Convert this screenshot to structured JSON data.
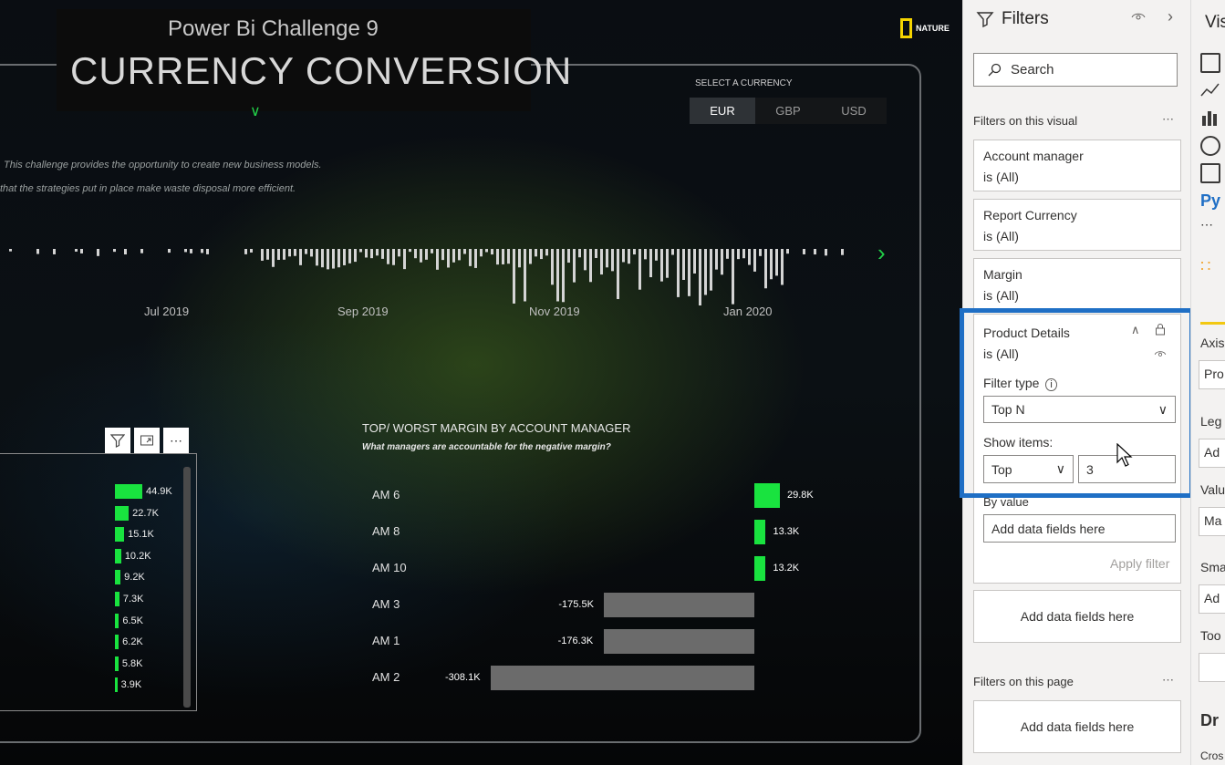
{
  "report": {
    "subtitle": "Power Bi Challenge 9",
    "title": "CURRENCY CONVERSION",
    "logo_text": "NATURE",
    "currency_label": "SELECT A CURRENCY",
    "currencies": [
      "EUR",
      "GBP",
      "USD"
    ],
    "selected_currency": "EUR",
    "description_line1": "This challenge provides the opportunity to create new business models.",
    "description_line2": "that the strategies put in place make waste disposal more efficient.",
    "timeline_dates": [
      "Jul 2019",
      "Sep 2019",
      "Nov 2019",
      "Jan 2020"
    ]
  },
  "left_visual": {
    "values": [
      "44.9K",
      "22.7K",
      "15.1K",
      "10.2K",
      "9.2K",
      "7.3K",
      "6.5K",
      "6.2K",
      "5.8K",
      "3.9K"
    ],
    "numeric": [
      44.9,
      22.7,
      15.1,
      10.2,
      9.2,
      7.3,
      6.5,
      6.2,
      5.8,
      3.9
    ]
  },
  "chart_data": {
    "type": "bar",
    "title": "TOP/ WORST MARGIN BY ACCOUNT MANAGER",
    "subtitle": "What managers are accountable for the negative margin?",
    "categories": [
      "AM 6",
      "AM 8",
      "AM 10",
      "AM 3",
      "AM 1",
      "AM 2"
    ],
    "values": [
      29.8,
      13.3,
      13.2,
      -175.5,
      -176.3,
      -308.1
    ],
    "labels": [
      "29.8K",
      "13.3K",
      "13.2K",
      "-175.5K",
      "-176.3K",
      "-308.1K"
    ],
    "positive_color": "#19e33f",
    "negative_color": "#6b6b6b"
  },
  "filters": {
    "title": "Filters",
    "search_placeholder": "Search",
    "visual_section": "Filters on this visual",
    "cards": [
      {
        "name": "Account manager",
        "state": "is (All)"
      },
      {
        "name": "Report Currency",
        "state": "is (All)"
      },
      {
        "name": "Margin",
        "state": "is (All)"
      }
    ],
    "product": {
      "name": "Product Details",
      "state": "is (All)",
      "filter_type_label": "Filter type",
      "filter_type": "Top N",
      "show_items_label": "Show items:",
      "show_items_dir": "Top",
      "show_items_count": "3",
      "by_value_label": "By value",
      "add_fields": "Add data fields here",
      "apply": "Apply filter"
    },
    "add_fields_visual": "Add data fields here",
    "page_section": "Filters on this page",
    "add_fields_page": "Add data fields here"
  },
  "visualizations": {
    "title": "Vis",
    "py": "Py",
    "axis": "Axis",
    "axis_value": "Pro",
    "legend": "Leg",
    "legend_value": "Ad",
    "values": "Valu",
    "values_value": "Ma",
    "small": "Sma",
    "small_value": "Ad",
    "tooltips": "Too",
    "drill": "Dr",
    "cross": "Cros"
  }
}
